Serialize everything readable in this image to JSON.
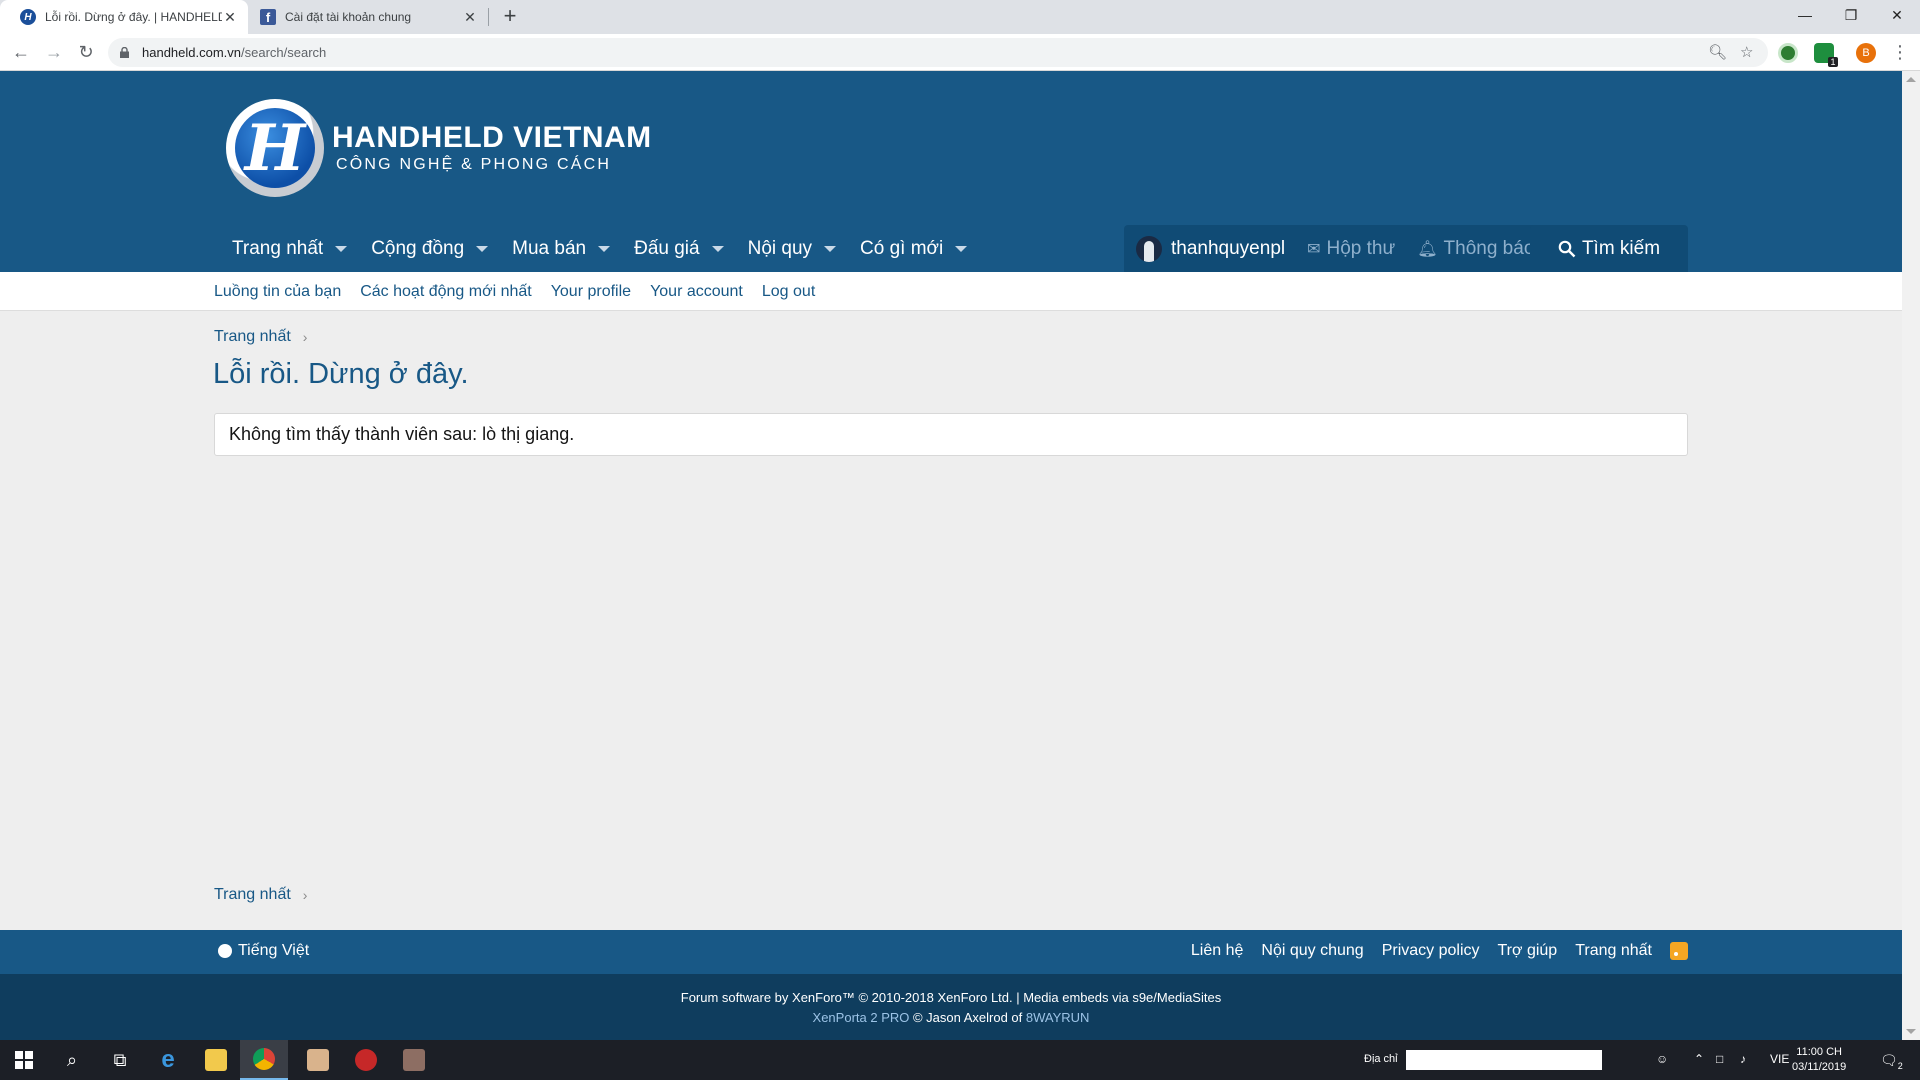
{
  "browser": {
    "tabs": [
      {
        "title": "Lỗi rồi. Dừng ở đây. | HANDHELD",
        "close": "✕"
      },
      {
        "title": "Cài đặt tài khoản chung",
        "close": "✕"
      }
    ],
    "new_tab": "+",
    "url_host": "handheld.com.vn",
    "url_path": "/search/search",
    "profile_initial": "B",
    "ext_badge": "1"
  },
  "site": {
    "logo_title": "HANDHELD VIETNAM",
    "logo_subtitle": "CÔNG NGHỆ & PHONG CÁCH",
    "nav": [
      "Trang nhất",
      "Cộng đồng",
      "Mua bán",
      "Đấu giá",
      "Nội quy",
      "Có gì mới"
    ],
    "account": {
      "username": "thanhquyenpl",
      "inbox": "Hộp thư",
      "alerts": "Thông báo"
    },
    "search_label": "Tìm kiếm",
    "subnav": [
      "Luồng tin của bạn",
      "Các hoạt động mới nhất",
      "Your profile",
      "Your account",
      "Log out"
    ]
  },
  "main": {
    "breadcrumb": "Trang nhất",
    "title": "Lỗi rồi. Dừng ở đây.",
    "message": "Không tìm thấy thành viên sau: lò thị giang.",
    "breadcrumb_bottom": "Trang nhất"
  },
  "footer": {
    "language": "Tiếng Việt",
    "links": [
      "Liên hệ",
      "Nội quy chung",
      "Privacy policy",
      "Trợ giúp",
      "Trang nhất"
    ],
    "copyright": "Forum software by XenForo™ © 2010-2018 XenForo Ltd. | Media embeds via s9e/MediaSites",
    "credit_product": "XenPorta 2 PRO",
    "credit_middle": " © Jason Axelrod of ",
    "credit_company": "8WAYRUN"
  },
  "taskbar": {
    "address_label": "Địa chỉ",
    "language": "VIE",
    "time": "11:00 CH",
    "date": "03/11/2019",
    "notification_count": "2"
  },
  "colors": {
    "header": "#185886",
    "link": "#185886",
    "footer": "#0f3d5e"
  }
}
